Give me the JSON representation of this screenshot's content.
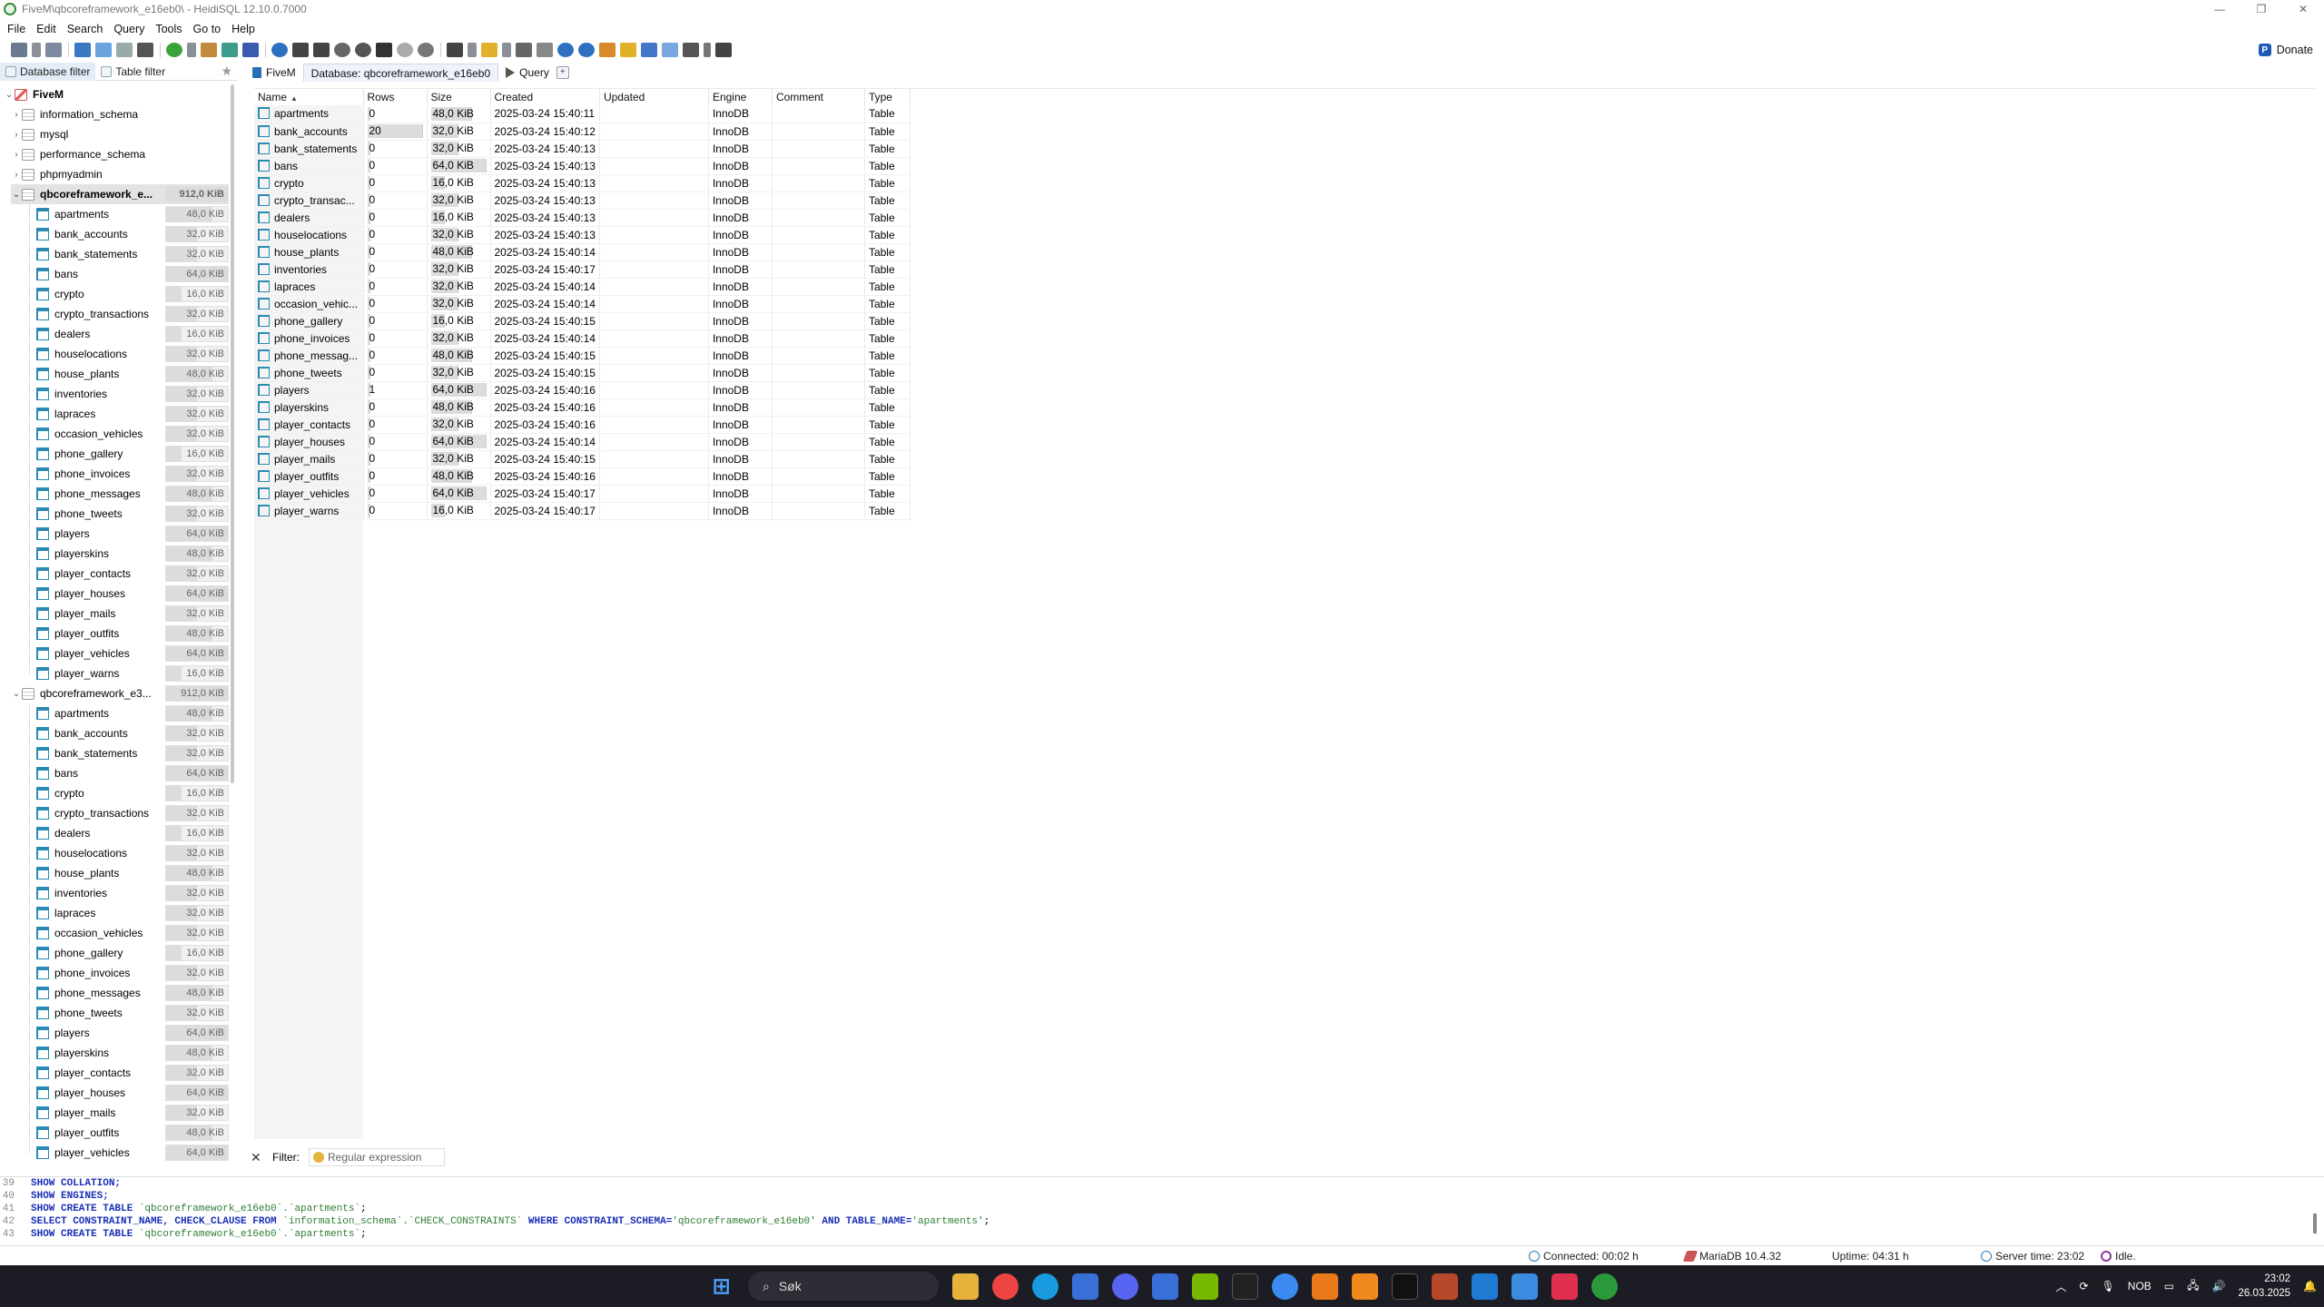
{
  "window": {
    "title": "FiveM\\qbcoreframework_e16eb0\\ - HeidiSQL 12.10.0.7000",
    "controls": [
      "—",
      "❐",
      "✕"
    ]
  },
  "menu": [
    "File",
    "Edit",
    "Search",
    "Query",
    "Tools",
    "Go to",
    "Help"
  ],
  "toolbar": {
    "donate_label": "Donate"
  },
  "left_filters": {
    "database": "Database filter",
    "table": "Table filter"
  },
  "tree": {
    "root": "FiveM",
    "databases": [
      "information_schema",
      "mysql",
      "performance_schema",
      "phpmyadmin"
    ],
    "db1": {
      "name": "qbcoreframework_e...",
      "size": "912,0 KiB"
    },
    "db2": {
      "name": "qbcoreframework_e3...",
      "size": "912,0 KiB"
    },
    "tables": [
      {
        "name": "apartments",
        "size": "48,0 KiB",
        "pct": 0.75
      },
      {
        "name": "bank_accounts",
        "size": "32,0 KiB",
        "pct": 0.5
      },
      {
        "name": "bank_statements",
        "size": "32,0 KiB",
        "pct": 0.5
      },
      {
        "name": "bans",
        "size": "64,0 KiB",
        "pct": 1.0
      },
      {
        "name": "crypto",
        "size": "16,0 KiB",
        "pct": 0.25
      },
      {
        "name": "crypto_transactions",
        "size": "32,0 KiB",
        "pct": 0.5
      },
      {
        "name": "dealers",
        "size": "16,0 KiB",
        "pct": 0.25
      },
      {
        "name": "houselocations",
        "size": "32,0 KiB",
        "pct": 0.5
      },
      {
        "name": "house_plants",
        "size": "48,0 KiB",
        "pct": 0.75
      },
      {
        "name": "inventories",
        "size": "32,0 KiB",
        "pct": 0.5
      },
      {
        "name": "lapraces",
        "size": "32,0 KiB",
        "pct": 0.5
      },
      {
        "name": "occasion_vehicles",
        "size": "32,0 KiB",
        "pct": 0.5
      },
      {
        "name": "phone_gallery",
        "size": "16,0 KiB",
        "pct": 0.25
      },
      {
        "name": "phone_invoices",
        "size": "32,0 KiB",
        "pct": 0.5
      },
      {
        "name": "phone_messages",
        "size": "48,0 KiB",
        "pct": 0.75
      },
      {
        "name": "phone_tweets",
        "size": "32,0 KiB",
        "pct": 0.5
      },
      {
        "name": "players",
        "size": "64,0 KiB",
        "pct": 1.0
      },
      {
        "name": "playerskins",
        "size": "48,0 KiB",
        "pct": 0.75
      },
      {
        "name": "player_contacts",
        "size": "32,0 KiB",
        "pct": 0.5
      },
      {
        "name": "player_houses",
        "size": "64,0 KiB",
        "pct": 1.0
      },
      {
        "name": "player_mails",
        "size": "32,0 KiB",
        "pct": 0.5
      },
      {
        "name": "player_outfits",
        "size": "48,0 KiB",
        "pct": 0.75
      },
      {
        "name": "player_vehicles",
        "size": "64,0 KiB",
        "pct": 1.0
      },
      {
        "name": "player_warns",
        "size": "16,0 KiB",
        "pct": 0.25
      }
    ]
  },
  "tabs": [
    "FiveM",
    "Database: qbcoreframework_e16eb0",
    "Query"
  ],
  "grid": {
    "columns": [
      "Name",
      "Rows",
      "Size",
      "Created",
      "Updated",
      "Engine",
      "Comment",
      "Type"
    ],
    "rows": [
      {
        "name": "apartments",
        "rows": "0",
        "rows_pct": 0,
        "size": "48,0 KiB",
        "size_pct": 0.75,
        "created": "2025-03-24 15:40:11",
        "updated": "",
        "engine": "InnoDB",
        "comment": "",
        "type": "Table"
      },
      {
        "name": "bank_accounts",
        "rows": "20",
        "rows_pct": 1.0,
        "size": "32,0 KiB",
        "size_pct": 0.5,
        "created": "2025-03-24 15:40:12",
        "updated": "",
        "engine": "InnoDB",
        "comment": "",
        "type": "Table"
      },
      {
        "name": "bank_statements",
        "rows": "0",
        "rows_pct": 0,
        "size": "32,0 KiB",
        "size_pct": 0.5,
        "created": "2025-03-24 15:40:13",
        "updated": "",
        "engine": "InnoDB",
        "comment": "",
        "type": "Table"
      },
      {
        "name": "bans",
        "rows": "0",
        "rows_pct": 0,
        "size": "64,0 KiB",
        "size_pct": 1.0,
        "created": "2025-03-24 15:40:13",
        "updated": "",
        "engine": "InnoDB",
        "comment": "",
        "type": "Table"
      },
      {
        "name": "crypto",
        "rows": "0",
        "rows_pct": 0,
        "size": "16,0 KiB",
        "size_pct": 0.25,
        "created": "2025-03-24 15:40:13",
        "updated": "",
        "engine": "InnoDB",
        "comment": "",
        "type": "Table"
      },
      {
        "name": "crypto_transac...",
        "rows": "0",
        "rows_pct": 0,
        "size": "32,0 KiB",
        "size_pct": 0.5,
        "created": "2025-03-24 15:40:13",
        "updated": "",
        "engine": "InnoDB",
        "comment": "",
        "type": "Table"
      },
      {
        "name": "dealers",
        "rows": "0",
        "rows_pct": 0,
        "size": "16,0 KiB",
        "size_pct": 0.25,
        "created": "2025-03-24 15:40:13",
        "updated": "",
        "engine": "InnoDB",
        "comment": "",
        "type": "Table"
      },
      {
        "name": "houselocations",
        "rows": "0",
        "rows_pct": 0,
        "size": "32,0 KiB",
        "size_pct": 0.5,
        "created": "2025-03-24 15:40:13",
        "updated": "",
        "engine": "InnoDB",
        "comment": "",
        "type": "Table"
      },
      {
        "name": "house_plants",
        "rows": "0",
        "rows_pct": 0,
        "size": "48,0 KiB",
        "size_pct": 0.75,
        "created": "2025-03-24 15:40:14",
        "updated": "",
        "engine": "InnoDB",
        "comment": "",
        "type": "Table"
      },
      {
        "name": "inventories",
        "rows": "0",
        "rows_pct": 0,
        "size": "32,0 KiB",
        "size_pct": 0.5,
        "created": "2025-03-24 15:40:17",
        "updated": "",
        "engine": "InnoDB",
        "comment": "",
        "type": "Table"
      },
      {
        "name": "lapraces",
        "rows": "0",
        "rows_pct": 0,
        "size": "32,0 KiB",
        "size_pct": 0.5,
        "created": "2025-03-24 15:40:14",
        "updated": "",
        "engine": "InnoDB",
        "comment": "",
        "type": "Table"
      },
      {
        "name": "occasion_vehic...",
        "rows": "0",
        "rows_pct": 0,
        "size": "32,0 KiB",
        "size_pct": 0.5,
        "created": "2025-03-24 15:40:14",
        "updated": "",
        "engine": "InnoDB",
        "comment": "",
        "type": "Table"
      },
      {
        "name": "phone_gallery",
        "rows": "0",
        "rows_pct": 0,
        "size": "16,0 KiB",
        "size_pct": 0.25,
        "created": "2025-03-24 15:40:15",
        "updated": "",
        "engine": "InnoDB",
        "comment": "",
        "type": "Table"
      },
      {
        "name": "phone_invoices",
        "rows": "0",
        "rows_pct": 0,
        "size": "32,0 KiB",
        "size_pct": 0.5,
        "created": "2025-03-24 15:40:14",
        "updated": "",
        "engine": "InnoDB",
        "comment": "",
        "type": "Table"
      },
      {
        "name": "phone_messag...",
        "rows": "0",
        "rows_pct": 0,
        "size": "48,0 KiB",
        "size_pct": 0.75,
        "created": "2025-03-24 15:40:15",
        "updated": "",
        "engine": "InnoDB",
        "comment": "",
        "type": "Table"
      },
      {
        "name": "phone_tweets",
        "rows": "0",
        "rows_pct": 0,
        "size": "32,0 KiB",
        "size_pct": 0.5,
        "created": "2025-03-24 15:40:15",
        "updated": "",
        "engine": "InnoDB",
        "comment": "",
        "type": "Table"
      },
      {
        "name": "players",
        "rows": "1",
        "rows_pct": 0.05,
        "size": "64,0 KiB",
        "size_pct": 1.0,
        "created": "2025-03-24 15:40:16",
        "updated": "",
        "engine": "InnoDB",
        "comment": "",
        "type": "Table"
      },
      {
        "name": "playerskins",
        "rows": "0",
        "rows_pct": 0,
        "size": "48,0 KiB",
        "size_pct": 0.75,
        "created": "2025-03-24 15:40:16",
        "updated": "",
        "engine": "InnoDB",
        "comment": "",
        "type": "Table"
      },
      {
        "name": "player_contacts",
        "rows": "0",
        "rows_pct": 0,
        "size": "32,0 KiB",
        "size_pct": 0.5,
        "created": "2025-03-24 15:40:16",
        "updated": "",
        "engine": "InnoDB",
        "comment": "",
        "type": "Table"
      },
      {
        "name": "player_houses",
        "rows": "0",
        "rows_pct": 0,
        "size": "64,0 KiB",
        "size_pct": 1.0,
        "created": "2025-03-24 15:40:14",
        "updated": "",
        "engine": "InnoDB",
        "comment": "",
        "type": "Table"
      },
      {
        "name": "player_mails",
        "rows": "0",
        "rows_pct": 0,
        "size": "32,0 KiB",
        "size_pct": 0.5,
        "created": "2025-03-24 15:40:15",
        "updated": "",
        "engine": "InnoDB",
        "comment": "",
        "type": "Table"
      },
      {
        "name": "player_outfits",
        "rows": "0",
        "rows_pct": 0,
        "size": "48,0 KiB",
        "size_pct": 0.75,
        "created": "2025-03-24 15:40:16",
        "updated": "",
        "engine": "InnoDB",
        "comment": "",
        "type": "Table"
      },
      {
        "name": "player_vehicles",
        "rows": "0",
        "rows_pct": 0,
        "size": "64,0 KiB",
        "size_pct": 1.0,
        "created": "2025-03-24 15:40:17",
        "updated": "",
        "engine": "InnoDB",
        "comment": "",
        "type": "Table"
      },
      {
        "name": "player_warns",
        "rows": "0",
        "rows_pct": 0,
        "size": "16,0 KiB",
        "size_pct": 0.25,
        "created": "2025-03-24 15:40:17",
        "updated": "",
        "engine": "InnoDB",
        "comment": "",
        "type": "Table"
      }
    ]
  },
  "filter": {
    "label": "Filter:",
    "placeholder": "Regular expression"
  },
  "sql_log": [
    {
      "n": "39",
      "parts": [
        [
          "kw",
          "SHOW COLLATION;"
        ]
      ]
    },
    {
      "n": "40",
      "parts": [
        [
          "kw",
          "SHOW ENGINES;"
        ]
      ]
    },
    {
      "n": "41",
      "parts": [
        [
          "kw",
          "SHOW CREATE TABLE "
        ],
        [
          "str",
          "`qbcoreframework_e16eb0`.`apartments`"
        ],
        [
          "",
          ";"
        ]
      ]
    },
    {
      "n": "42",
      "parts": [
        [
          "kw",
          "SELECT CONSTRAINT_NAME, CHECK_CLAUSE FROM "
        ],
        [
          "str",
          "`information_schema`.`CHECK_CONSTRAINTS`"
        ],
        [
          "kw",
          " WHERE CONSTRAINT_SCHEMA="
        ],
        [
          "str",
          "'qbcoreframework_e16eb0'"
        ],
        [
          "kw",
          " AND TABLE_NAME="
        ],
        [
          "str",
          "'apartments'"
        ],
        [
          "",
          ";"
        ]
      ]
    },
    {
      "n": "43",
      "parts": [
        [
          "kw",
          "SHOW CREATE TABLE "
        ],
        [
          "str",
          "`qbcoreframework_e16eb0`.`apartments`"
        ],
        [
          "",
          ";"
        ]
      ]
    }
  ],
  "status": {
    "connected": "Connected: 00:02 h",
    "server": "MariaDB 10.4.32",
    "uptime": "Uptime: 04:31 h",
    "server_time": "Server time: 23:02",
    "state": "Idle."
  },
  "taskbar": {
    "search_label": "Søk",
    "lang": "NOB",
    "time": "23:02",
    "date": "26.03.2025"
  }
}
